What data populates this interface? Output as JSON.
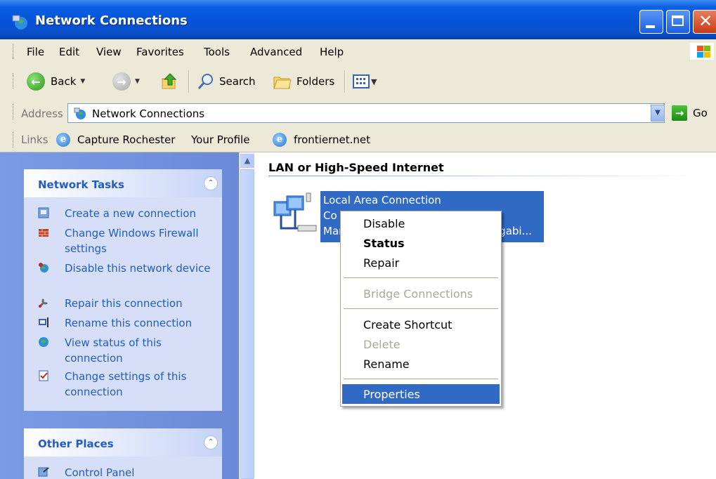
{
  "window": {
    "title": "Network Connections"
  },
  "menubar": {
    "items": [
      "File",
      "Edit",
      "View",
      "Favorites",
      "Tools",
      "Advanced",
      "Help"
    ]
  },
  "toolbar": {
    "back_label": "Back",
    "search_label": "Search",
    "folders_label": "Folders"
  },
  "address": {
    "label": "Address",
    "value": "Network Connections",
    "go_label": "Go"
  },
  "links": {
    "label": "Links",
    "items": [
      "Capture Rochester",
      "Your Profile",
      "frontiernet.net"
    ]
  },
  "tasks_panel": {
    "title": "Network Tasks",
    "items": [
      "Create a new connection",
      "Change Windows Firewall settings",
      "Disable this network device",
      "Repair this connection",
      "Rename this connection",
      "View status of this connection",
      "Change settings of this connection"
    ]
  },
  "other_panel": {
    "title": "Other Places",
    "items": [
      "Control Panel"
    ]
  },
  "content": {
    "group_title": "LAN or High-Speed Internet",
    "connection": {
      "name": "Local Area Connection",
      "line2": "Co",
      "line3_left": "Mar",
      "line3_right": "igabi..."
    }
  },
  "context_menu": {
    "items": [
      "Disable",
      "Status",
      "Repair",
      "Bridge Connections",
      "Create Shortcut",
      "Delete",
      "Rename",
      "Properties"
    ],
    "highlighted": "Properties"
  },
  "colors": {
    "titlebar": "#0553d8",
    "selection": "#316ac5",
    "task_link": "#215dc6",
    "pane_bg": "#6a8ad8"
  }
}
